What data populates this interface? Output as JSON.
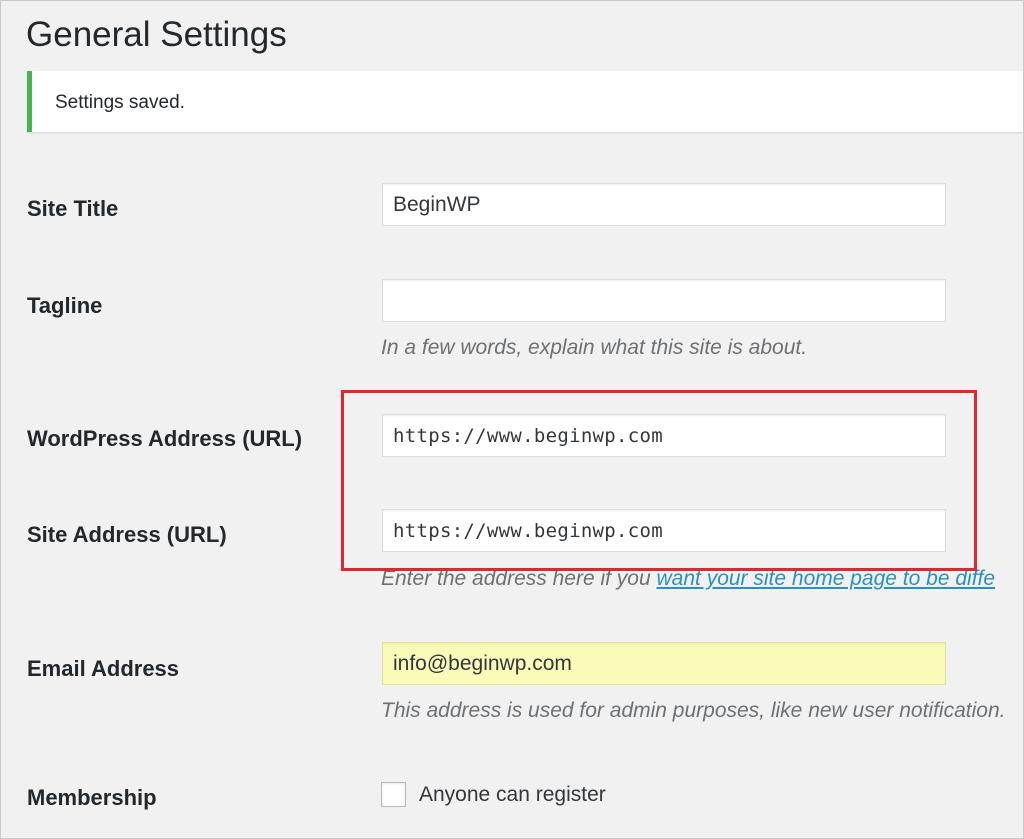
{
  "page": {
    "title": "General Settings"
  },
  "notice": {
    "message": "Settings saved.",
    "accent_color": "#46b450"
  },
  "fields": {
    "site_title": {
      "label": "Site Title",
      "value": "BeginWP"
    },
    "tagline": {
      "label": "Tagline",
      "value": "",
      "description": "In a few words, explain what this site is about."
    },
    "wordpress_address": {
      "label": "WordPress Address (URL)",
      "value": "https://www.beginwp.com"
    },
    "site_address": {
      "label": "Site Address (URL)",
      "value": "https://www.beginwp.com",
      "description_prefix": "Enter the address here if you ",
      "description_link": "want your site home page to be diffe"
    },
    "email": {
      "label": "Email Address",
      "value": "info@beginwp.com",
      "description": "This address is used for admin purposes, like new user notification."
    },
    "membership": {
      "label": "Membership",
      "checkbox_label": "Anyone can register",
      "checked": false
    }
  },
  "highlight": {
    "color": "#e0262e"
  }
}
